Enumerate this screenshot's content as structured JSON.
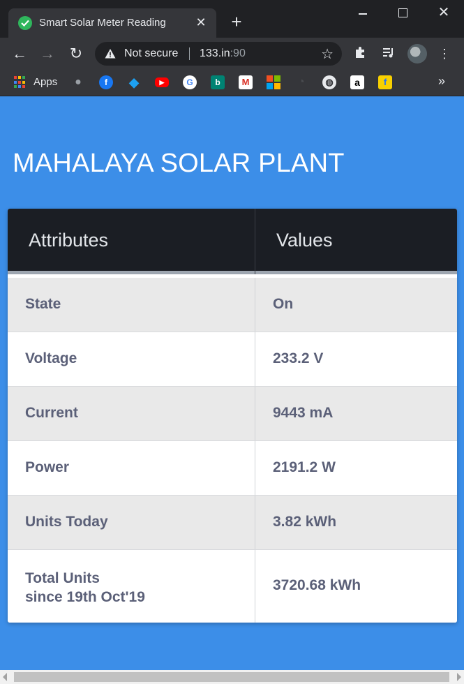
{
  "browser": {
    "tab_title": "Smart Solar Meter Reading",
    "new_tab_symbol": "+",
    "not_secure_label": "Not secure",
    "url_host": "133.in",
    "url_port": ":90",
    "apps_label": "Apps",
    "bookmarks": [
      "apple-icon",
      "facebook-icon",
      "twitter-icon",
      "youtube-icon",
      "google-icon",
      "bing-icon",
      "gmail-icon",
      "microsoft-icon",
      "speedometer-icon",
      "globe-icon",
      "amazon-icon",
      "flipkart-icon"
    ],
    "accent_colors": {
      "chrome_dark": "#202124",
      "chrome_toolbar": "#35363a",
      "page_bg": "#3c8ee8"
    }
  },
  "page": {
    "heading": "MAHALAYA SOLAR PLANT",
    "table": {
      "headers": [
        "Attributes",
        "Values"
      ],
      "rows": [
        {
          "attribute": "State",
          "value": "On"
        },
        {
          "attribute": "Voltage",
          "value": "233.2 V"
        },
        {
          "attribute": "Current",
          "value": "9443 mA"
        },
        {
          "attribute": "Power",
          "value": "2191.2 W"
        },
        {
          "attribute": "Units Today",
          "value": "3.82 kWh"
        },
        {
          "attribute": "Total Units\nsince 19th Oct'19",
          "attribute_line1": "Total Units",
          "attribute_line2": "since 19th Oct'19",
          "value": "3720.68 kWh"
        }
      ]
    }
  }
}
